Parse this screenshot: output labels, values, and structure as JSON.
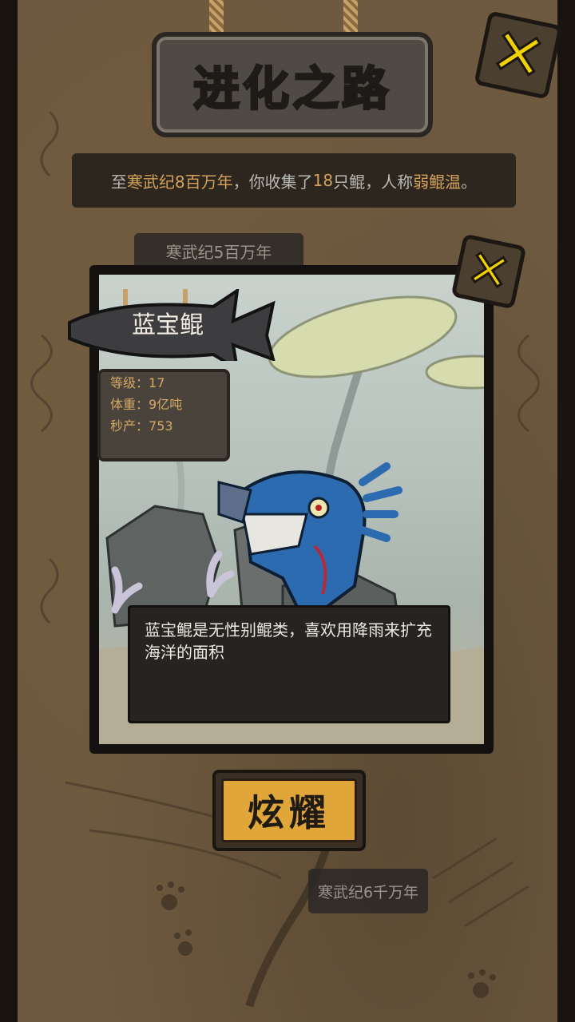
{
  "header": {
    "title": "进化之路"
  },
  "banner": {
    "parts": [
      "至",
      "寒武纪8百万年",
      "，你收集了",
      "18",
      "只鲲，人称",
      "弱鲲温",
      "。"
    ]
  },
  "era_tags": {
    "previous": "寒武纪5百万年",
    "next": "寒武纪6千万年"
  },
  "creature": {
    "name": "蓝宝鲲",
    "stats": [
      {
        "label": "等级：",
        "value": "17"
      },
      {
        "label": "体重：",
        "value": "9亿吨"
      },
      {
        "label": "秒产：",
        "value": "753"
      }
    ],
    "description": "蓝宝鲲是无性别鲲类，喜欢用降雨来扩充海洋的面积"
  },
  "actions": {
    "show_off_label": "炫耀",
    "close_glyph": "✕"
  },
  "colors": {
    "accent_gold": "#d4a25a",
    "close_yellow": "#f1d200",
    "button_orange": "#e0a63a"
  }
}
